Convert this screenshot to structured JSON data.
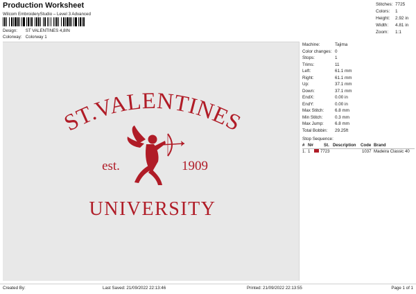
{
  "header": {
    "title": "Production Worksheet",
    "subtitle": "Wilcom EmbroideryStudio – Level 3 Advanced",
    "barcode_suffix": ",",
    "design_label": "Design:",
    "design_value": "ST VALENTINES 4,8IN",
    "colorway_label": "Colorway:",
    "colorway_value": "Colorway 1"
  },
  "stats": [
    {
      "label": "Stitches:",
      "value": "7725"
    },
    {
      "label": "Colors:",
      "value": "1"
    },
    {
      "label": "Height:",
      "value": "2.92 in"
    },
    {
      "label": "Width:",
      "value": "4.81 in"
    },
    {
      "label": "Zoom:",
      "value": "1:1"
    }
  ],
  "design": {
    "line1": "ST.VALENTINES",
    "est": "est.",
    "year": "1909",
    "line2": "UNIVERSITY",
    "thread_color": "#b01c27",
    "background_color": "#e8e8e8"
  },
  "machine_info": [
    {
      "label": "Machine:",
      "value": "Tajima"
    },
    {
      "label": "Color changes:",
      "value": "0"
    },
    {
      "label": "Stops:",
      "value": "1"
    },
    {
      "label": "Trims:",
      "value": "11"
    },
    {
      "label": "Left:",
      "value": "61.1 mm"
    },
    {
      "label": "Right:",
      "value": "61.1 mm"
    },
    {
      "label": "Up:",
      "value": "37.1 mm"
    },
    {
      "label": "Down:",
      "value": "37.1 mm"
    },
    {
      "label": "EndX:",
      "value": "0.00 in"
    },
    {
      "label": "EndY:",
      "value": "0.00 in"
    },
    {
      "label": "Max Stitch:",
      "value": "6.8 mm"
    },
    {
      "label": "Min Stitch:",
      "value": "0.3 mm"
    },
    {
      "label": "Max Jump:",
      "value": "6.8 mm"
    },
    {
      "label": "Total Bobbin:",
      "value": "29.25ft"
    }
  ],
  "stop_sequence": {
    "title": "Stop Sequence:",
    "columns": [
      "#",
      "N#",
      "St.",
      "Description",
      "Code",
      "Brand"
    ],
    "rows": [
      {
        "num": "1.",
        "n": "1",
        "st": "7723",
        "description": "",
        "code": "1037",
        "brand": "Madeira Classic 40",
        "color": "#b01c27"
      }
    ]
  },
  "footer": {
    "created_by": "Created By:",
    "last_saved": "Last Saved: 21/09/2022 22:13:46",
    "printed": "Printed: 21/09/2022 22:13:55",
    "page": "Page 1 of 1"
  }
}
